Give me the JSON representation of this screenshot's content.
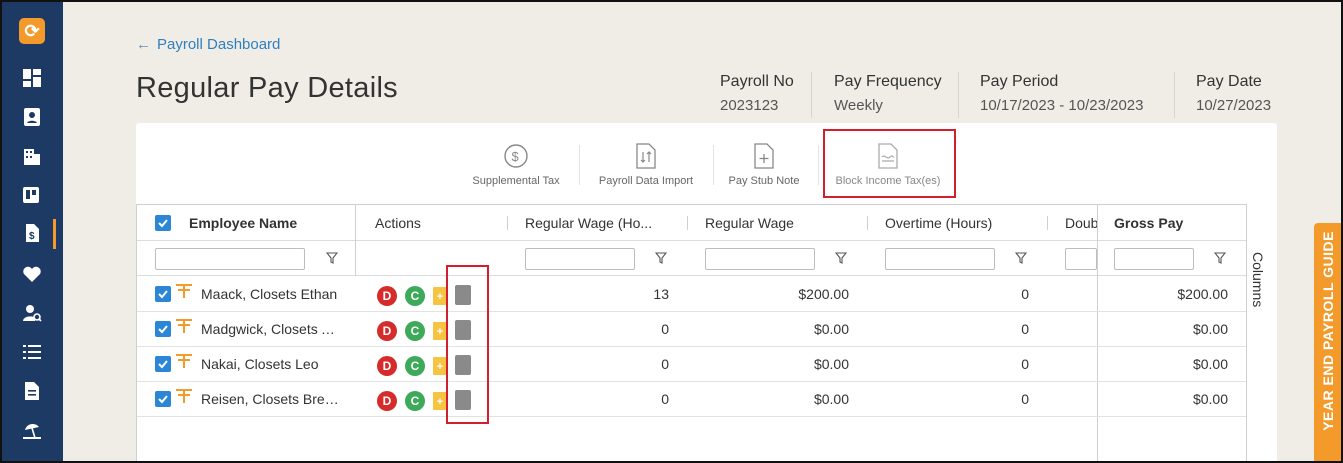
{
  "header": {
    "back_label": "Payroll Dashboard",
    "title": "Regular Pay Details",
    "meta": [
      {
        "label": "Payroll No",
        "value": "2023123"
      },
      {
        "label": "Pay Frequency",
        "value": "Weekly"
      },
      {
        "label": "Pay Period",
        "value": "10/17/2023 - 10/23/2023"
      },
      {
        "label": "Pay Date",
        "value": "10/27/2023"
      }
    ]
  },
  "toolbar": {
    "supplemental_tax": "Supplemental Tax",
    "payroll_data_import": "Payroll Data Import",
    "pay_stub_note": "Pay Stub Note",
    "block_income_tax": "Block Income Tax(es)"
  },
  "grid": {
    "columns": {
      "employee_name": "Employee Name",
      "actions": "Actions",
      "regular_wage_hours": "Regular Wage (Ho...",
      "regular_wage": "Regular Wage",
      "overtime_hours": "Overtime (Hours)",
      "double": "Doub",
      "gross_pay": "Gross Pay"
    },
    "rows": [
      {
        "name": "Maack, Closets Ethan",
        "reg_hours": "13",
        "reg_wage": "$200.00",
        "ot_hours": "0",
        "gross": "$200.00"
      },
      {
        "name": "Madgwick, Closets A...",
        "reg_hours": "0",
        "reg_wage": "$0.00",
        "ot_hours": "0",
        "gross": "$0.00"
      },
      {
        "name": "Nakai, Closets Leo",
        "reg_hours": "0",
        "reg_wage": "$0.00",
        "ot_hours": "0",
        "gross": "$0.00"
      },
      {
        "name": "Reisen, Closets Brea...",
        "reg_hours": "0",
        "reg_wage": "$0.00",
        "ot_hours": "0",
        "gross": "$0.00"
      }
    ],
    "action_badges": {
      "d": "D",
      "c": "C",
      "plus": "+"
    },
    "columns_tab": "Columns"
  },
  "side_tab": "YEAR END PAYROLL GUIDE",
  "colors": {
    "accent": "#f39a2a",
    "sidebar": "#1c3a63",
    "link": "#2f7fc1",
    "highlight": "#d0202d"
  },
  "sidebar_icons": [
    "logo-icon",
    "dashboard-icon",
    "contact-card-icon",
    "building-icon",
    "board-icon",
    "payroll-doc-icon",
    "heart-icon",
    "user-search-icon",
    "checklist-icon",
    "document-icon",
    "beach-icon"
  ]
}
